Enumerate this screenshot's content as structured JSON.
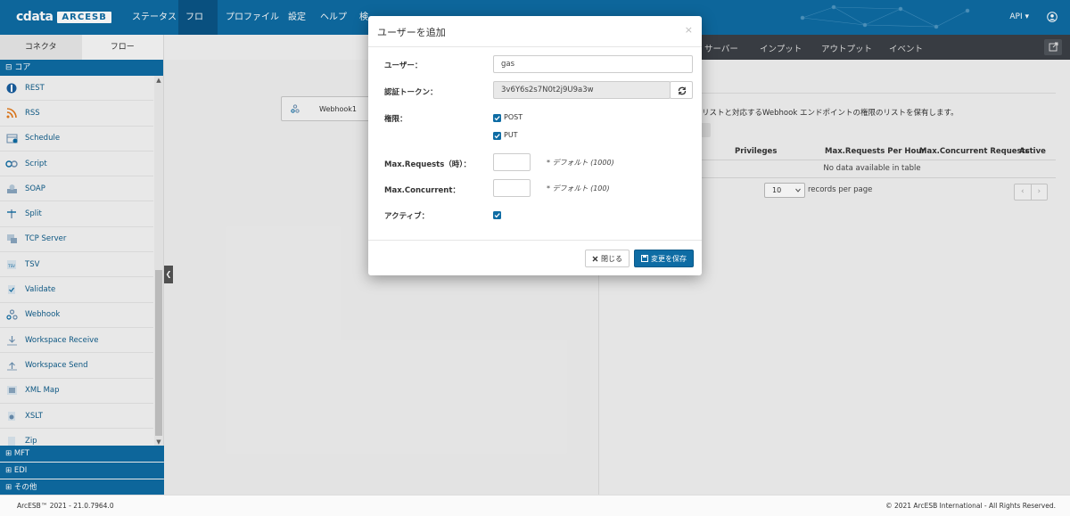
{
  "app": {
    "logo_cdata": "cdata",
    "logo_product": "ARCESB"
  },
  "topnav": {
    "items": [
      "ステータス",
      "フロー",
      "プロファイル",
      "設定",
      "ヘルプ",
      "検"
    ],
    "api_label": "API ▾"
  },
  "left": {
    "tabs": [
      "コネクタ",
      "フロー"
    ],
    "category_core": "⊟ コア",
    "connectors": [
      {
        "label": "REST",
        "icon": "rest-icon"
      },
      {
        "label": "RSS",
        "icon": "rss-icon"
      },
      {
        "label": "Schedule",
        "icon": "schedule-icon"
      },
      {
        "label": "Script",
        "icon": "script-icon"
      },
      {
        "label": "SOAP",
        "icon": "soap-icon"
      },
      {
        "label": "Split",
        "icon": "split-icon"
      },
      {
        "label": "TCP Server",
        "icon": "tcp-server-icon"
      },
      {
        "label": "TSV",
        "icon": "tsv-icon"
      },
      {
        "label": "Validate",
        "icon": "validate-icon"
      },
      {
        "label": "Webhook",
        "icon": "webhook-icon"
      },
      {
        "label": "Workspace Receive",
        "icon": "workspace-receive-icon"
      },
      {
        "label": "Workspace Send",
        "icon": "workspace-send-icon"
      },
      {
        "label": "XML Map",
        "icon": "xml-map-icon"
      },
      {
        "label": "XSLT",
        "icon": "xslt-icon"
      },
      {
        "label": "Zip",
        "icon": "zip-icon"
      }
    ],
    "categories_bottom": [
      "⊞ MFT",
      "⊞ EDI",
      "⊞ その他"
    ]
  },
  "canvas": {
    "node_label": "Webhook1"
  },
  "right": {
    "tabs": [
      "サーバー",
      "インプット",
      "アウトプット",
      "イベント"
    ],
    "description": "リストと対応するWebhook エンドポイントの権限のリストを保有します。",
    "table_headers": [
      "Privileges",
      "Max.Requests Per Hour",
      "Max.Concurrent Requests",
      "Active"
    ],
    "no_data": "No data available in table",
    "rpp_value": "10",
    "rpp_label": "records per page",
    "pager_prev": "‹",
    "pager_next": "›"
  },
  "modal": {
    "title": "ユーザーを追加",
    "close_glyph": "×",
    "user_label": "ユーザー：",
    "user_value": "gas",
    "token_label": "認証トークン：",
    "token_value": "3v6Y6s2s7N0t2j9U9a3w",
    "privileges_label": "権限：",
    "priv_post": "POST",
    "priv_put": "PUT",
    "maxreq_label": "Max.Requests（時）：",
    "maxreq_value": "",
    "maxreq_hint": "* デフォルト (1000)",
    "maxconc_label": "Max.Concurrent：",
    "maxconc_value": "",
    "maxconc_hint": "* デフォルト (100)",
    "active_label": "アクティブ：",
    "btn_close": "閉じる",
    "btn_save": "変更を保存"
  },
  "footer": {
    "left": "ArcESB™ 2021 - 21.0.7964.0",
    "right": "© 2021 ArcESB International - All Rights Reserved."
  },
  "colors": {
    "primary": "#0e6ca4",
    "dark_tab": "#3c4046"
  }
}
